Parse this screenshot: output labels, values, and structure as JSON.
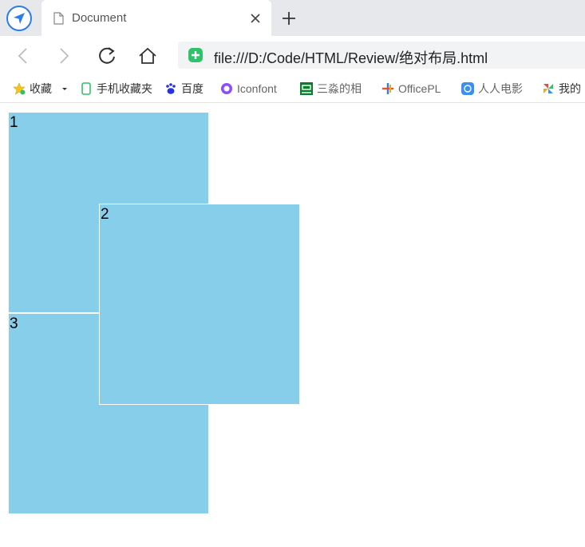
{
  "tab": {
    "title": "Document"
  },
  "toolbar": {
    "url": "file:///D:/Code/HTML/Review/绝对布局.html"
  },
  "bookmarks": [
    {
      "label": "收藏",
      "icon": "star-icon"
    },
    {
      "label": "手机收藏夹",
      "icon": "phone-icon"
    },
    {
      "label": "百度",
      "icon": "baidu-paw-icon"
    },
    {
      "label": "Iconfont",
      "icon": "iconfont-icon"
    },
    {
      "label": "三淼的相",
      "icon": "douban-icon"
    },
    {
      "label": "OfficePL",
      "icon": "officeplus-icon"
    },
    {
      "label": "人人电影",
      "icon": "rr-icon"
    },
    {
      "label": "我的",
      "icon": "pinwheel-icon"
    }
  ],
  "boxes": [
    {
      "label": "1"
    },
    {
      "label": "2"
    },
    {
      "label": "3"
    }
  ],
  "colors": {
    "box": "#87ceeb",
    "accent": "#2b7de9",
    "secure": "#2fc26b"
  }
}
